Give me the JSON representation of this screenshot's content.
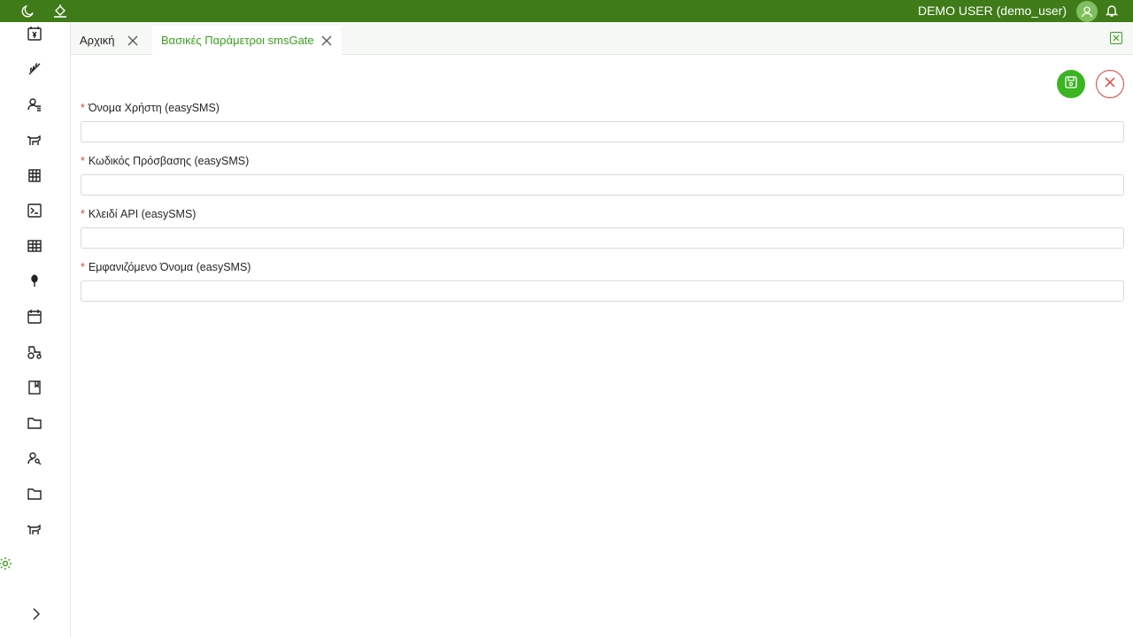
{
  "topbar": {
    "icons": [
      "moon-icon",
      "paint-bucket-icon",
      "bell-icon",
      "user-avatar-icon"
    ],
    "user_label": "DEMO USER (demo_user)"
  },
  "sidebar": {
    "items": [
      {
        "icon": "calendar-yen-icon"
      },
      {
        "icon": "wheat-icon"
      },
      {
        "icon": "user-list-icon"
      },
      {
        "icon": "cow-icon"
      },
      {
        "icon": "barn-icon"
      },
      {
        "icon": "terminal-icon"
      },
      {
        "icon": "table-icon"
      },
      {
        "icon": "leaf-icon"
      },
      {
        "icon": "calendar-icon"
      },
      {
        "icon": "tractor-icon"
      },
      {
        "icon": "book-icon"
      },
      {
        "icon": "folder-icon"
      },
      {
        "icon": "user-search-icon"
      },
      {
        "icon": "folder-icon"
      },
      {
        "icon": "cow-icon"
      }
    ],
    "settings_icon": "gear-icon",
    "expand_icon": "chevron-right-icon"
  },
  "tabs": [
    {
      "label": "Αρχική",
      "active": false
    },
    {
      "label": "Βασικές Παράμετροι smsGate",
      "active": true
    }
  ],
  "actions": {
    "save_icon": "save-icon",
    "cancel_icon": "close-icon"
  },
  "form": {
    "fields": [
      {
        "label": "Όνομα Χρήστη (easySMS)",
        "required": true,
        "value": ""
      },
      {
        "label": "Κωδικός Πρόσβασης (easySMS)",
        "required": true,
        "value": ""
      },
      {
        "label": "Κλειδί API (easySMS)",
        "required": true,
        "value": ""
      },
      {
        "label": "Εμφανιζόμενο Όνομα (easySMS)",
        "required": true,
        "value": ""
      }
    ]
  },
  "colors": {
    "topbar": "#3f7b18",
    "accent": "#3aa11f",
    "save": "#3cb424",
    "danger": "#e0403a"
  }
}
